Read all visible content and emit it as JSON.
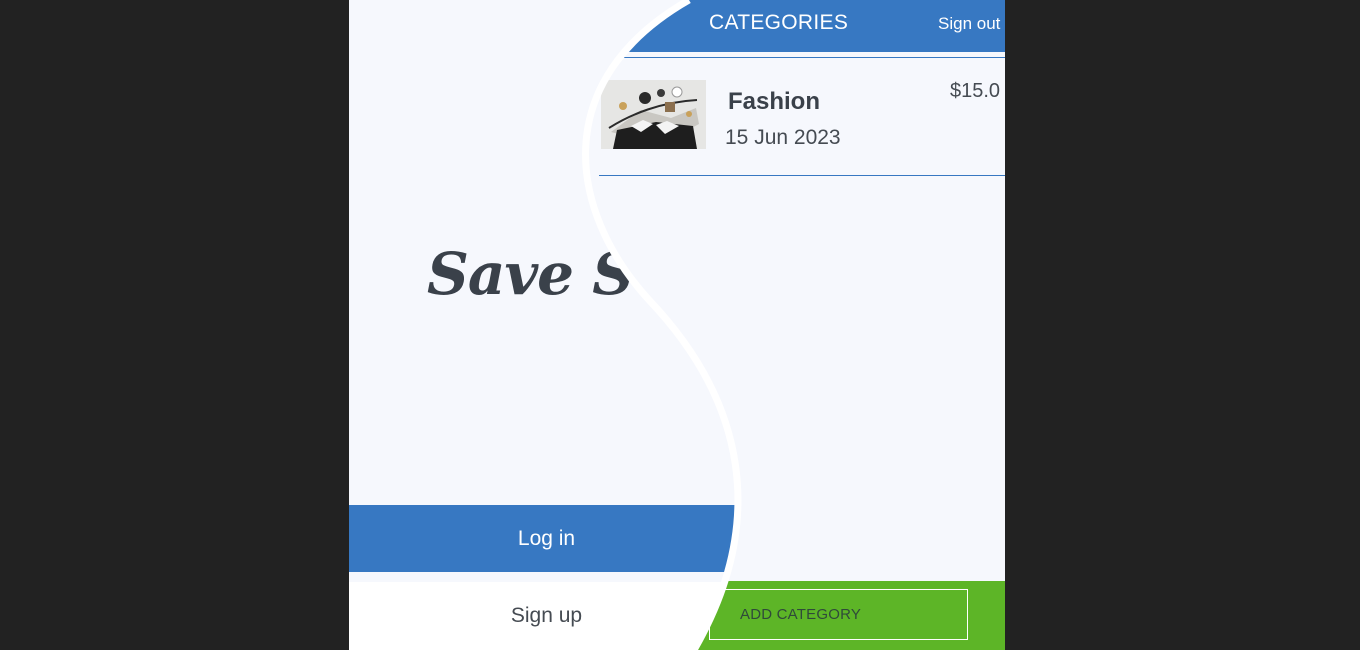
{
  "splash": {
    "brand": "Save Sens",
    "login_label": "Log in",
    "signup_label": "Sign up"
  },
  "header": {
    "title": "CATEGORIES",
    "signout_label": "Sign out"
  },
  "categories": [
    {
      "name": "Fashion",
      "date": "15 Jun 2023",
      "amount": "$15.0",
      "icon": "fashion-accessories-thumbnail"
    }
  ],
  "footer": {
    "add_label": "ADD CATEGORY"
  },
  "colors": {
    "primary_blue": "#3778c2",
    "accent_green": "#5db527",
    "background": "#f6f8fd",
    "text_dark": "#3a414a",
    "page_backdrop": "#222222"
  }
}
